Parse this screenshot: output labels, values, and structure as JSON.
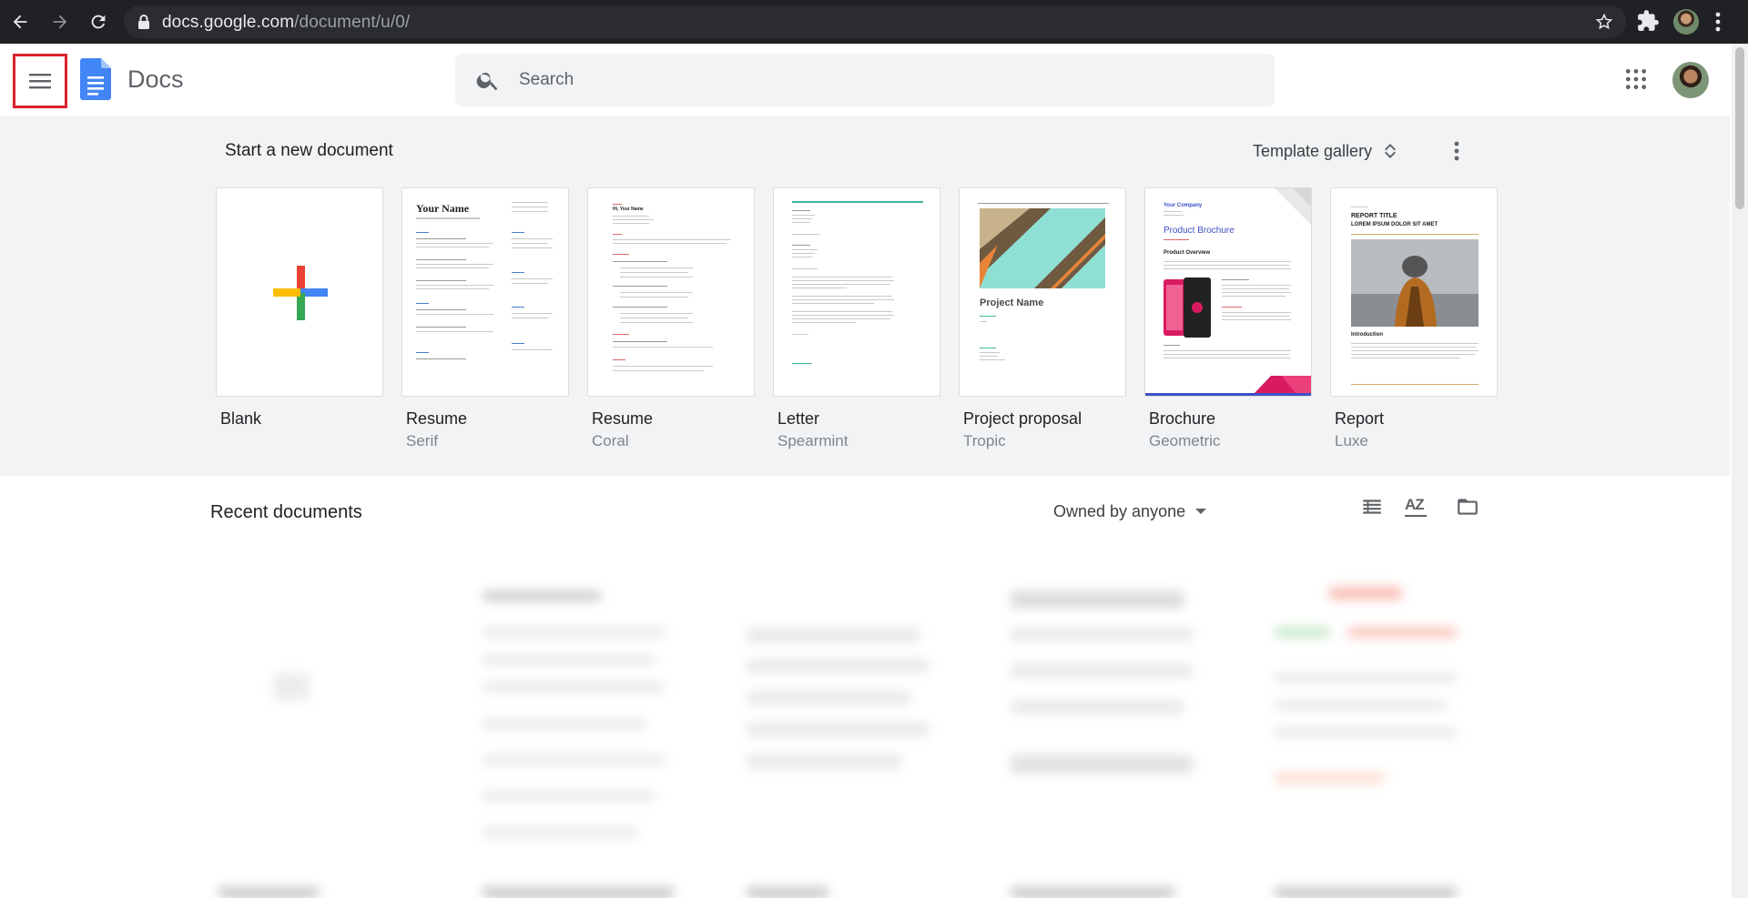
{
  "browser": {
    "url_domain": "docs.google.com",
    "url_path": "/document/u/0/"
  },
  "header": {
    "app_name": "Docs",
    "search_placeholder": "Search"
  },
  "start": {
    "title": "Start a new document",
    "gallery_label": "Template gallery",
    "templates": [
      {
        "name": "Blank",
        "sub": ""
      },
      {
        "name": "Resume",
        "sub": "Serif"
      },
      {
        "name": "Resume",
        "sub": "Coral"
      },
      {
        "name": "Letter",
        "sub": "Spearmint"
      },
      {
        "name": "Project proposal",
        "sub": "Tropic"
      },
      {
        "name": "Brochure",
        "sub": "Geometric"
      },
      {
        "name": "Report",
        "sub": "Luxe"
      }
    ],
    "thumb_text": {
      "resume_serif_heading": "Your Name",
      "resume_coral_heading": "Hi, Your Name",
      "project_name": "Project Name",
      "brochure_company": "Your Company",
      "brochure_title": "Product Brochure",
      "brochure_overview": "Product Overview",
      "report_label": "REPORT TITLE",
      "report_heading": "LOREM IPSUM DOLOR SIT AMET",
      "report_intro": "Introduction"
    }
  },
  "recent": {
    "title": "Recent documents",
    "owner_filter": "Owned by anyone",
    "sort_label": "AZ"
  },
  "colors": {
    "chrome_bg": "#202124",
    "docs_blue": "#4285f4",
    "highlight_red": "#d9232d",
    "section_bg": "#f1f3f4"
  },
  "icons": [
    "back-icon",
    "forward-icon",
    "reload-icon",
    "lock-icon",
    "star-icon",
    "extensions-icon",
    "kebab-menu-icon",
    "hamburger-menu-icon",
    "docs-logo-icon",
    "search-icon",
    "apps-grid-icon",
    "unfold-icon",
    "list-view-icon",
    "sort-az-icon",
    "folder-icon"
  ]
}
